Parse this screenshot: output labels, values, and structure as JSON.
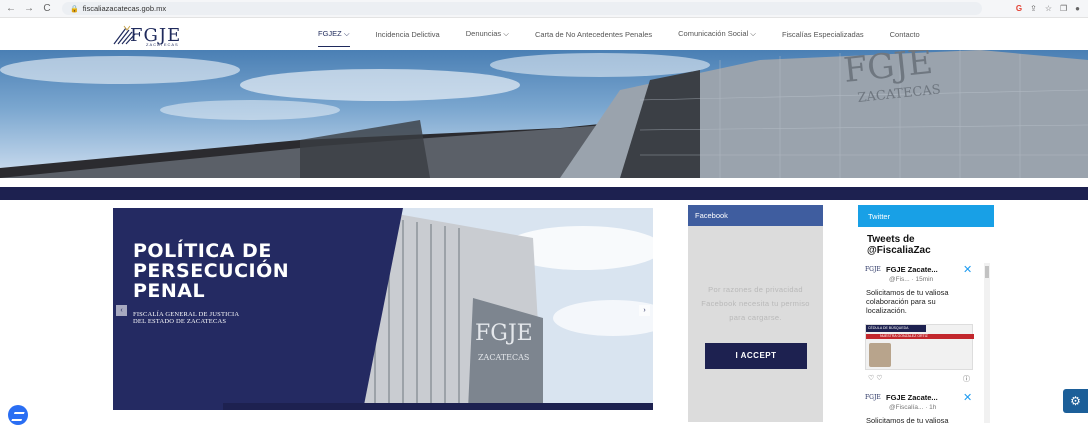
{
  "browser": {
    "url": "fiscaliazacatecas.gob.mx",
    "back": "←",
    "forward": "→",
    "reload": "C"
  },
  "header": {
    "logo_text": "FGJE",
    "logo_sub": "ZACATECAS",
    "nav": [
      {
        "label": "FGJEZ ⌵",
        "active": true
      },
      {
        "label": "Incidencia Delictiva"
      },
      {
        "label": "Denuncias ⌵"
      },
      {
        "label": "Carta de No Antecedentes Penales"
      },
      {
        "label": "Comunicación Social ⌵"
      },
      {
        "label": "Fiscalías Especializadas"
      },
      {
        "label": "Contacto"
      }
    ]
  },
  "hero": {
    "building_sign_1": "FGJE",
    "building_sign_2": "ZACATECAS"
  },
  "slider": {
    "title_lines": [
      "POLÍTICA DE",
      "PERSECUCIÓN",
      "PENAL"
    ],
    "subtitle_lines": [
      "FISCALÍA GENERAL DE JUSTICIA",
      "DEL ESTADO DE ZACATECAS"
    ],
    "prev": "‹",
    "next": "›"
  },
  "facebook": {
    "header": "Facebook",
    "message": "Por razones de privacidad Facebook necesita tu permiso para cargarse.",
    "accept": "I ACCEPT"
  },
  "twitter": {
    "header": "Twitter",
    "title_line1": "Tweets de",
    "title_line2": "@FiscaliaZac",
    "tweets": [
      {
        "name": "FGJE Zacate...",
        "handle": "@Fis... · 15min",
        "text": "Solicitamos de tu valiosa colaboración para su localización.",
        "media_banner": "CÉDULA DE BÚSQUEDA",
        "media_name": "NUESTRA GONZÁLEZ ORTIZ"
      },
      {
        "name": "FGJE Zacate...",
        "handle": "@Fiscalía... · 1h",
        "text": "Solicitamos de tu valiosa"
      }
    ]
  },
  "colors": {
    "navy": "#1d2150",
    "facebook_blue": "#3f5d9f",
    "twitter_blue": "#18a0e6",
    "messenger_blue": "#2a6ef3",
    "accessibility_blue": "#1c5f99"
  }
}
